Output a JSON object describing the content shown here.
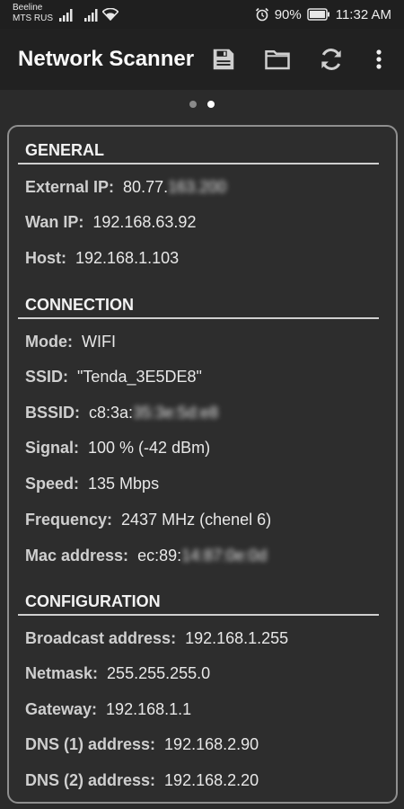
{
  "status_bar": {
    "carrier_1": "Beeline",
    "carrier_2": "MTS RUS",
    "battery": "90%",
    "time": "11:32 AM"
  },
  "app_bar": {
    "title": "Network Scanner",
    "actions": [
      "save-icon",
      "folder-icon",
      "refresh-icon",
      "more-vert-icon"
    ]
  },
  "pager": {
    "pages": 2,
    "active_page": 2
  },
  "general": {
    "header": "GENERAL",
    "external_ip_label": "External IP:",
    "external_ip_value": "80.77.",
    "external_ip_hidden": "163.200",
    "wan_ip_label": "Wan IP:",
    "wan_ip_value": "192.168.63.92",
    "host_label": "Host:",
    "host_value": "192.168.1.103"
  },
  "connection": {
    "header": "CONNECTION",
    "mode_label": "Mode:",
    "mode_value": "WIFI",
    "ssid_label": "SSID:",
    "ssid_value": "\"Tenda_3E5DE8\"",
    "bssid_label": "BSSID:",
    "bssid_value": "c8:3a:",
    "bssid_hidden": "35:3e:5d:e8",
    "signal_label": "Signal:",
    "signal_value": "100 % (-42 dBm)",
    "speed_label": "Speed:",
    "speed_value": "135 Mbps",
    "frequency_label": "Frequency:",
    "frequency_value": "2437 MHz (chenel 6)",
    "mac_label": "Mac address:",
    "mac_value": "ec:89:",
    "mac_hidden": "14:87:0e:0d"
  },
  "configuration": {
    "header": "CONFIGURATION",
    "broadcast_label": "Broadcast address:",
    "broadcast_value": "192.168.1.255",
    "netmask_label": "Netmask:",
    "netmask_value": "255.255.255.0",
    "gateway_label": "Gateway:",
    "gateway_value": "192.168.1.1",
    "dns1_label": "DNS (1) address:",
    "dns1_value": "192.168.2.90",
    "dns2_label": "DNS (2) address:",
    "dns2_value": "192.168.2.20"
  }
}
